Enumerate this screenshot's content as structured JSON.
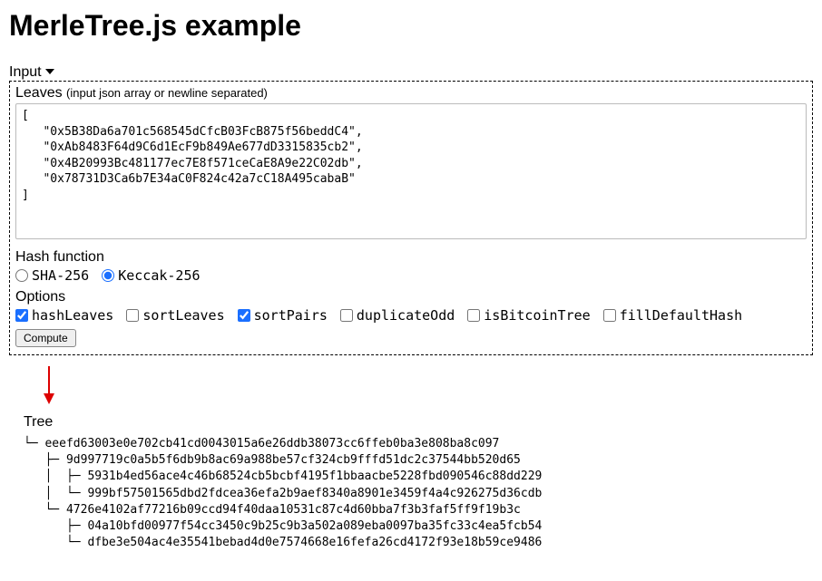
{
  "title": "MerleTree.js example",
  "inputSection": {
    "headerLabel": "Input",
    "leavesLabel": "Leaves",
    "leavesHint": "(input json array or newline separated)",
    "leavesValue": "[\n   \"0x5B38Da6a701c568545dCfcB03FcB875f56beddC4\",\n   \"0xAb8483F64d9C6d1EcF9b849Ae677dD3315835cb2\",\n   \"0x4B20993Bc481177ec7E8f571ceCaE8A9e22C02db\",\n   \"0x78731D3Ca6b7E34aC0F824c42a7cC18A495cabaB\"\n]"
  },
  "hashFunction": {
    "label": "Hash function",
    "options": [
      {
        "name": "SHA-256",
        "checked": false
      },
      {
        "name": "Keccak-256",
        "checked": true
      }
    ]
  },
  "options": {
    "label": "Options",
    "items": [
      {
        "name": "hashLeaves",
        "checked": true
      },
      {
        "name": "sortLeaves",
        "checked": false
      },
      {
        "name": "sortPairs",
        "checked": true
      },
      {
        "name": "duplicateOdd",
        "checked": false
      },
      {
        "name": "isBitcoinTree",
        "checked": false
      },
      {
        "name": "fillDefaultHash",
        "checked": false
      }
    ]
  },
  "computeLabel": "Compute",
  "treeSection": {
    "label": "Tree",
    "ascii": "└─ eeefd63003e0e702cb41cd0043015a6e26ddb38073cc6ffeb0ba3e808ba8c097\n   ├─ 9d997719c0a5b5f6db9b8ac69a988be57cf324cb9fffd51dc2c37544bb520d65\n   │  ├─ 5931b4ed56ace4c46b68524cb5bcbf4195f1bbaacbe5228fbd090546c88dd229\n   │  └─ 999bf57501565dbd2fdcea36efa2b9aef8340a8901e3459f4a4c926275d36cdb\n   └─ 4726e4102af77216b09ccd94f40daa10531c87c4d60bba7f3b3faf5ff9f19b3c\n      ├─ 04a10bfd00977f54cc3450c9b25c9b3a502a089eba0097ba35fc33c4ea5fcb54\n      └─ dfbe3e504ac4e35541bebad4d0e7574668e16fefa26cd4172f93e18b59ce9486"
  }
}
